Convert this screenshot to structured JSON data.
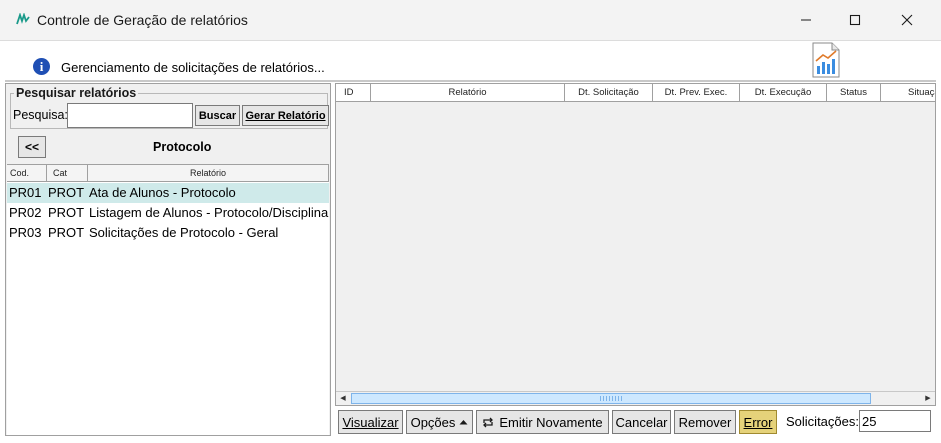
{
  "window": {
    "title": "Controle de Geração de relatórios"
  },
  "banner": {
    "message": "Gerenciamento de solicitações de relatórios..."
  },
  "search": {
    "group_title": "Pesquisar relatórios",
    "label": "Pesquisa:",
    "value": "",
    "buscar_label": "Buscar",
    "gerar_label": "Gerar Relatório"
  },
  "nav": {
    "back_label": "<<",
    "section_title": "Protocolo"
  },
  "reports_table": {
    "columns": [
      "Cod.",
      "Cat",
      "Relatório"
    ],
    "rows": [
      {
        "cod": "PR01",
        "cat": "PROT",
        "name": "Ata de Alunos - Protocolo"
      },
      {
        "cod": "PR02",
        "cat": "PROT",
        "name": "Listagem de Alunos - Protocolo/Disciplina"
      },
      {
        "cod": "PR03",
        "cat": "PROT",
        "name": "Solicitações de Protocolo - Geral"
      }
    ]
  },
  "requests_table": {
    "columns": [
      "ID",
      "Relatório",
      "Dt. Solicitação",
      "Dt. Prev. Exec.",
      "Dt. Execução",
      "Status",
      "Situação"
    ]
  },
  "actions": {
    "visualizar": "Visualizar",
    "opcoes": "Opções",
    "emitir": "Emitir Novamente",
    "cancelar": "Cancelar",
    "remover": "Remover",
    "error": "Error"
  },
  "status": {
    "solicitacoes_label": "Solicitações:",
    "solicitacoes_value": "25"
  },
  "colors": {
    "selected_row": "#cfeaea",
    "error_button": "#e5d27a",
    "info_icon": "#1f4fb4"
  }
}
